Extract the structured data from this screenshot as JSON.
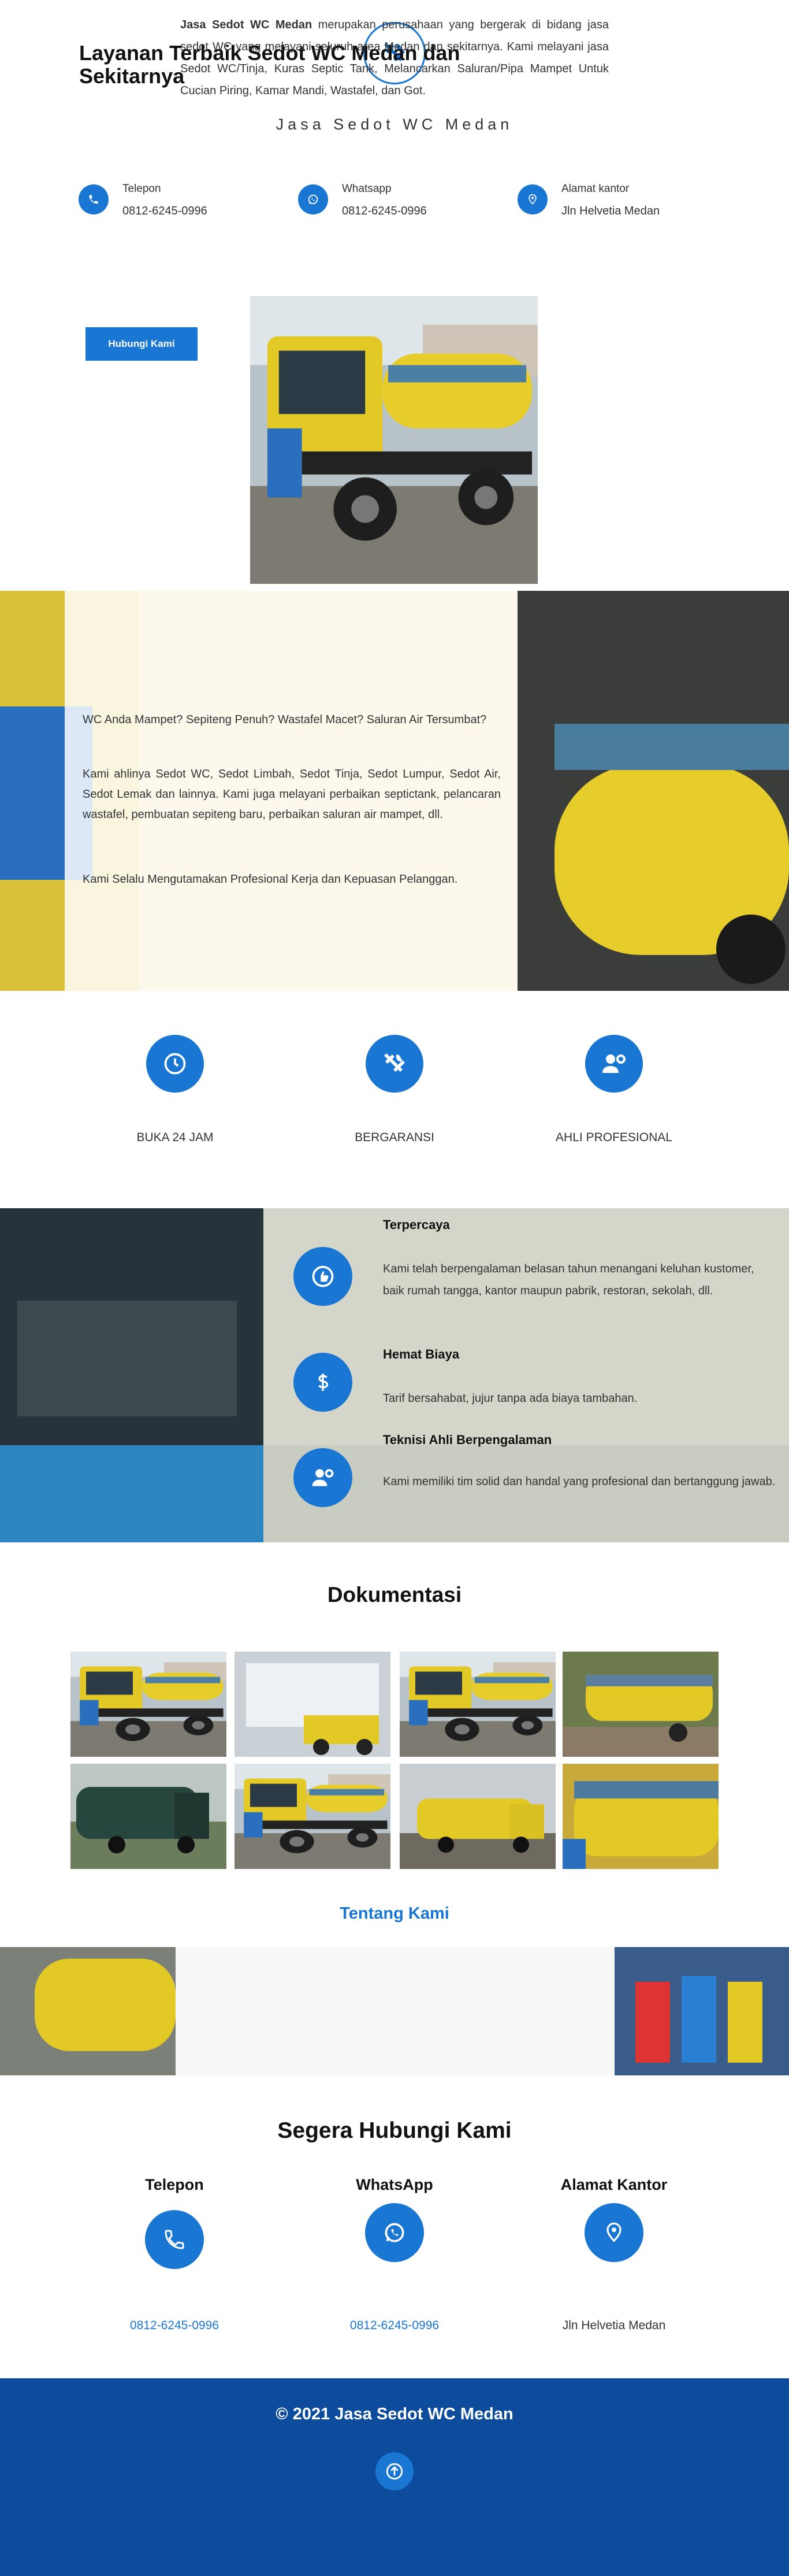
{
  "header": {
    "title": "Jasa Sedot WC Medan",
    "logo_icon": "tools-icon"
  },
  "contacts": [
    {
      "label": "Telepon",
      "value": "0812-6245-0996",
      "icon": "phone-icon"
    },
    {
      "label": "Whatsapp",
      "value": "0812-6245-0996",
      "icon": "whatsapp-icon"
    },
    {
      "label": "Alamat kantor",
      "value": "Jln Helvetia Medan",
      "icon": "location-pin-icon"
    }
  ],
  "services": {
    "title": "Layanan Terbaik Sedot WC Medan dan Sekitarnya",
    "p1": "WC Anda Mampet? Sepiteng Penuh? Wastafel Macet? Saluran Air Tersumbat?",
    "p2": "Kami ahlinya Sedot WC, Sedot Limbah, Sedot Tinja, Sedot Lumpur, Sedot Air, Sedot Lemak dan lainnya. Kami juga melayani perbaikan septictank, pelancaran wastafel, pembuatan sepiteng baru, perbaikan saluran air mampet, dll.",
    "p3": "Kami Selalu Mengutamakan Profesional Kerja dan Kepuasan Pelanggan.",
    "button": "Hubungi Kami"
  },
  "features": [
    {
      "label": "BUKA 24 JAM",
      "icon": "clock-icon"
    },
    {
      "label": "BERGARANSI",
      "icon": "tools-icon"
    },
    {
      "label": "AHLI PROFESIONAL",
      "icon": "user-gear-icon"
    }
  ],
  "why": [
    {
      "title": "Terpercaya",
      "text": "Kami telah berpengalaman belasan tahun menangani keluhan kustomer, baik rumah tangga, kantor maupun pabrik, restoran, sekolah, dll.",
      "icon": "thumbs-up-icon"
    },
    {
      "title": "Hemat Biaya",
      "text": "Tarif bersahabat, jujur tanpa ada biaya tambahan.",
      "icon": "dollar-icon"
    },
    {
      "title": "Teknisi Ahli Berpengalaman",
      "text": "Kami memiliki tim solid dan handal yang profesional dan bertanggung jawab.",
      "icon": "user-gear-icon"
    }
  ],
  "documentation": {
    "title": "Dokumentasi"
  },
  "about": {
    "title": "Tentang Kami",
    "strong": "Jasa Sedot WC Medan",
    "text": " merupakan perusahaan yang bergerak di bidang jasa sedot WC yang melayani seluruh area Medan dan sekitarnya. Kami melayani jasa Sedot WC/Tinja, Kuras Septic Tank, Melancarkan Saluran/Pipa Mampet Untuk Cucian Piring, Kamar Mandi, Wastafel, dan Got."
  },
  "contact": {
    "title": "Segera Hubungi Kami",
    "columns": [
      {
        "head": "Telepon",
        "value": "0812-6245-0996",
        "icon": "phone-icon"
      },
      {
        "head": "WhatsApp",
        "value": "0812-6245-0996",
        "icon": "whatsapp-icon"
      },
      {
        "head": "Alamat Kantor",
        "value": "Jln Helvetia Medan",
        "icon": "location-pin-icon"
      }
    ]
  },
  "footer": {
    "copyright": "© 2021 Jasa Sedot WC Medan",
    "scroll_icon": "arrow-up-icon"
  },
  "colors": {
    "primary": "#1976d2",
    "footer": "#0d4c9c",
    "truck_yellow": "#e8cf2a"
  }
}
